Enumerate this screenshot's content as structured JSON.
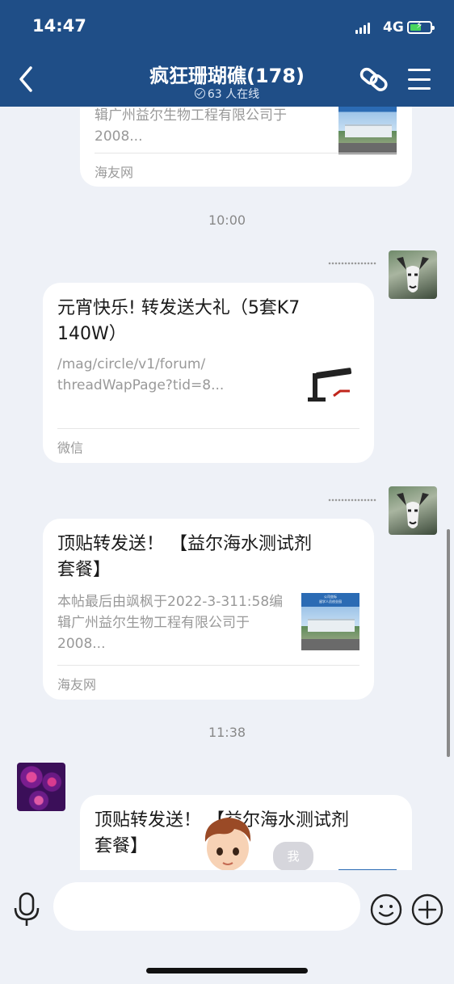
{
  "status_bar": {
    "time": "14:47",
    "network": "4G",
    "battery_level": 0.55
  },
  "header": {
    "title": "疯狂珊瑚礁(178)",
    "online": "63 人在线"
  },
  "colors": {
    "header_bg": "#1f4e87",
    "chat_bg": "#eef1f7",
    "card_bg": "#ffffff",
    "battery_green": "#49d55d"
  },
  "icons": {
    "back": "chevron-left-icon",
    "link": "link-icon",
    "menu": "menu-icon",
    "mic": "microphone-icon",
    "emoji": "smiley-icon",
    "plus": "plus-icon"
  },
  "messages": [
    {
      "type": "link-card",
      "desc": "辑广州益尔生物工程有限公司于\n2008...",
      "source": "海友网"
    },
    {
      "type": "time",
      "text": "10:00"
    },
    {
      "type": "link-card",
      "sender": "dots",
      "title": "元宵快乐! 转发送大礼（5套K7\n140W）",
      "desc": "/mag/circle/v1/forum/\nthreadWapPage?tid=8...",
      "source": "微信"
    },
    {
      "type": "link-card",
      "sender": "dots",
      "title": "顶贴转发送！ 【益尔海水测试剂\n套餐】",
      "desc": "本帖最后由飒枫于2022-3-311:58编\n辑广州益尔生物工程有限公司于\n2008...",
      "source": "海友网",
      "thumb_text": "公司坐标\n留学人员创业园"
    },
    {
      "type": "time",
      "text": "11:38"
    },
    {
      "type": "link-card",
      "title": "顶贴转发送！ 【益尔海水测试剂\n套餐】"
    }
  ],
  "floating_badge": "我",
  "input": {
    "value": "",
    "placeholder": ""
  }
}
